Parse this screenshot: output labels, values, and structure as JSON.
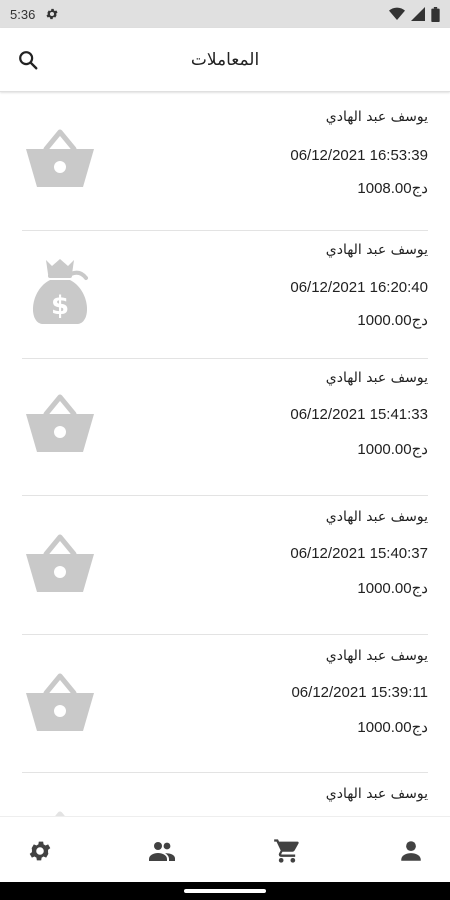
{
  "status_bar": {
    "time": "5:36",
    "icons": [
      "gear-icon",
      "wifi-icon",
      "signal-icon",
      "battery-icon"
    ]
  },
  "app_bar": {
    "title": "المعاملات",
    "search_icon": "search-icon"
  },
  "transactions": [
    {
      "name": "يوسف عبد الهادي",
      "datetime": "06/12/2021 16:53:39",
      "amount": "1008.00دج",
      "icon": "basket-icon"
    },
    {
      "name": "يوسف عبد الهادي",
      "datetime": "06/12/2021 16:20:40",
      "amount": "1000.00دج",
      "icon": "money-bag-icon"
    },
    {
      "name": "يوسف عبد الهادي",
      "datetime": "06/12/2021 15:41:33",
      "amount": "1000.00دج",
      "icon": "basket-icon"
    },
    {
      "name": "يوسف عبد الهادي",
      "datetime": "06/12/2021 15:40:37",
      "amount": "1000.00دج",
      "icon": "basket-icon"
    },
    {
      "name": "يوسف عبد الهادي",
      "datetime": "06/12/2021 15:39:11",
      "amount": "1000.00دج",
      "icon": "basket-icon"
    },
    {
      "name": "يوسف عبد الهادي",
      "icon": "basket-icon"
    }
  ],
  "bottom_nav": {
    "items": [
      "settings-icon",
      "people-icon",
      "cart-icon",
      "person-icon"
    ]
  },
  "colors": {
    "icon_gray": "#c9c9c9",
    "nav_icon": "#424242",
    "status_bar_bg": "#e0e0e0"
  }
}
